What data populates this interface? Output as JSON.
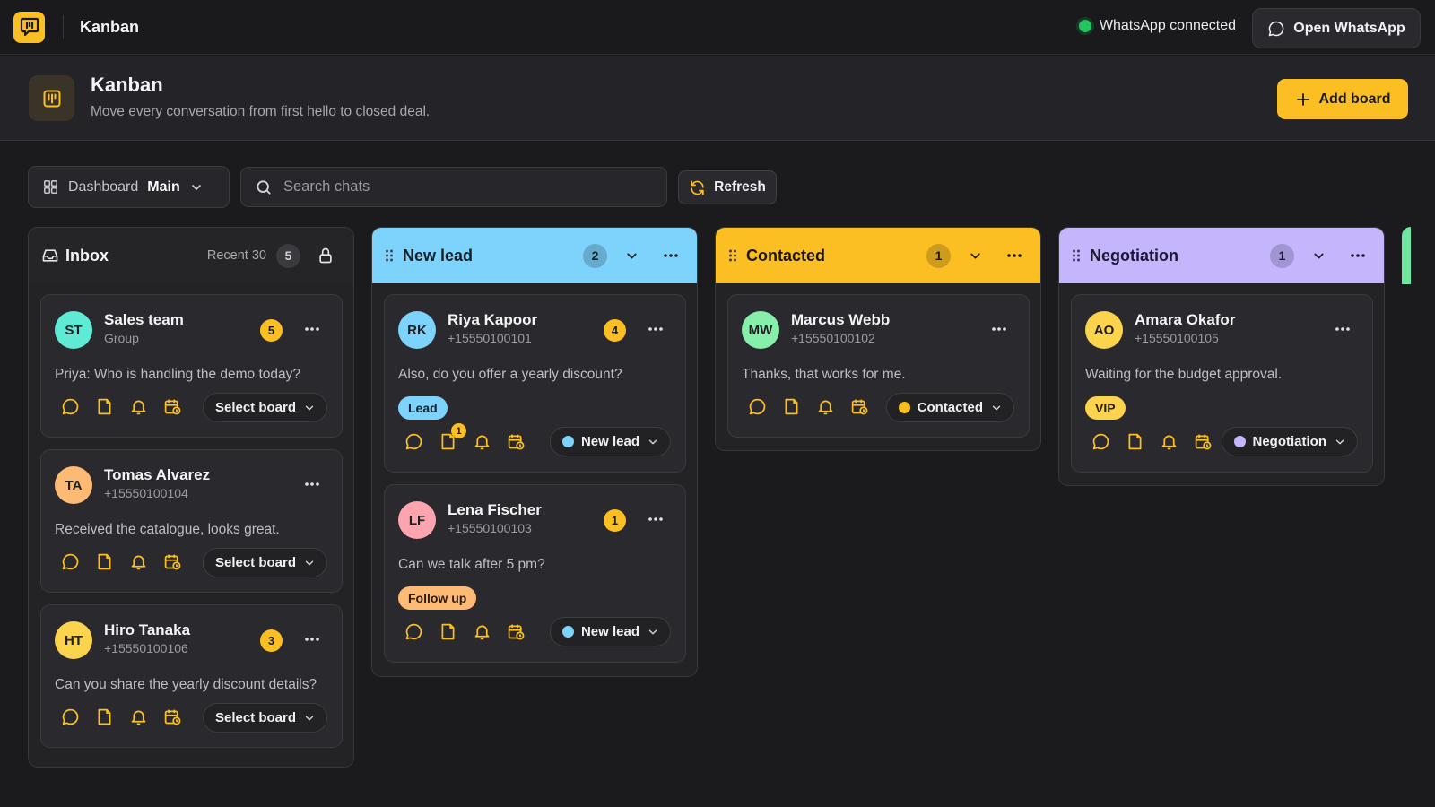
{
  "topbar": {
    "title": "Kanban",
    "status_text": "WhatsApp connected",
    "status_color": "#22c55e",
    "open_button": "Open WhatsApp"
  },
  "header": {
    "title": "Kanban",
    "subtitle": "Move every conversation from first hello to closed deal.",
    "add_button": "Add board"
  },
  "toolbar": {
    "dashboard_label": "Dashboard",
    "dashboard_value": "Main",
    "search_placeholder": "Search chats",
    "refresh_label": "Refresh"
  },
  "inbox": {
    "title": "Inbox",
    "recent_label": "Recent 30",
    "count": "5",
    "cards": [
      {
        "initials": "ST",
        "name": "Sales team",
        "sub": "Group",
        "unread": "5",
        "message": "Priya: Who is handling the demo today?",
        "board": "Select board",
        "avatar_color": "#5eead4"
      },
      {
        "initials": "TA",
        "name": "Tomas Alvarez",
        "sub": "+15550100104",
        "unread": "",
        "message": "Received the catalogue, looks great.",
        "board": "Select board",
        "avatar_color": "#fdba74"
      },
      {
        "initials": "HT",
        "name": "Hiro Tanaka",
        "sub": "+15550100106",
        "unread": "3",
        "message": "Can you share the yearly discount details?",
        "board": "Select board",
        "avatar_color": "#fcd34d"
      }
    ]
  },
  "columns": [
    {
      "title": "New lead",
      "count": "2",
      "color": "#7dd3fc",
      "cards": [
        {
          "initials": "RK",
          "name": "Riya Kapoor",
          "sub": "+15550100101",
          "unread": "4",
          "message": "Also, do you offer a yearly discount?",
          "tag": "Lead",
          "tag_color": "#7dd3fc",
          "notes_badge": "1",
          "board": "New lead",
          "board_color": "#7dd3fc",
          "avatar_color": "#7dd3fc"
        },
        {
          "initials": "LF",
          "name": "Lena Fischer",
          "sub": "+15550100103",
          "unread": "1",
          "message": "Can we talk after 5 pm?",
          "tag": "Follow up",
          "tag_color": "#fdba74",
          "notes_badge": "",
          "board": "New lead",
          "board_color": "#7dd3fc",
          "avatar_color": "#fda4af"
        }
      ]
    },
    {
      "title": "Contacted",
      "count": "1",
      "color": "#fbbf24",
      "cards": [
        {
          "initials": "MW",
          "name": "Marcus Webb",
          "sub": "+15550100102",
          "unread": "",
          "message": "Thanks, that works for me.",
          "tag": "",
          "tag_color": "",
          "notes_badge": "",
          "board": "Contacted",
          "board_color": "#fbbf24",
          "avatar_color": "#86efac"
        }
      ]
    },
    {
      "title": "Negotiation",
      "count": "1",
      "color": "#c4b5fd",
      "cards": [
        {
          "initials": "AO",
          "name": "Amara Okafor",
          "sub": "+15550100105",
          "unread": "",
          "message": "Waiting for the budget approval.",
          "tag": "VIP",
          "tag_color": "#fcd34d",
          "notes_badge": "",
          "board": "Negotiation",
          "board_color": "#c4b5fd",
          "avatar_color": "#fcd34d"
        }
      ]
    }
  ],
  "icons": [
    "app-logo-icon",
    "whatsapp-icon",
    "kanban-icon",
    "plus-icon",
    "grid-icon",
    "chevron-down-icon",
    "search-icon",
    "refresh-icon",
    "inbox-icon",
    "lock-icon",
    "drag-handle-icon",
    "more-icon",
    "chat-icon",
    "note-icon",
    "bell-icon",
    "calendar-clock-icon"
  ]
}
